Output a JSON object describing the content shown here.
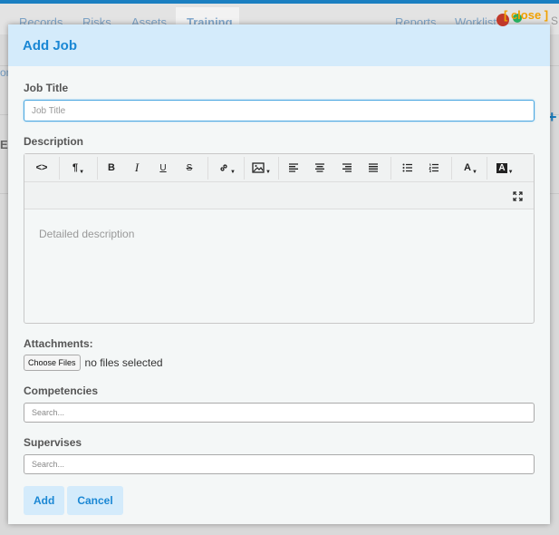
{
  "background": {
    "nav": [
      "Records",
      "Risks",
      "Assets",
      "Training",
      "Reports",
      "Worklist"
    ],
    "close_label": "[ close ]",
    "search_fragment": "S",
    "side_fragment": "on",
    "side_letter": "E",
    "plus": "+"
  },
  "modal": {
    "title": "Add Job",
    "job_title_label": "Job Title",
    "job_title_placeholder": "Job Title",
    "description_label": "Description",
    "description_placeholder": "Detailed description",
    "attachments_label": "Attachments:",
    "choose_files_label": "Choose Files",
    "file_status": "no files selected",
    "competencies_label": "Competencies",
    "competencies_placeholder": "Search...",
    "supervises_label": "Supervises",
    "supervises_placeholder": "Search...",
    "add_label": "Add",
    "cancel_label": "Cancel"
  },
  "toolbar": {
    "code": "<>",
    "paragraph": "¶",
    "bold": "B",
    "italic": "I",
    "underline": "U",
    "strike": "S",
    "font_color": "A",
    "highlight": "A"
  },
  "colors": {
    "accent": "#1a87d4",
    "header_bg": "#d4ebfb",
    "close_color": "#f0a000"
  }
}
